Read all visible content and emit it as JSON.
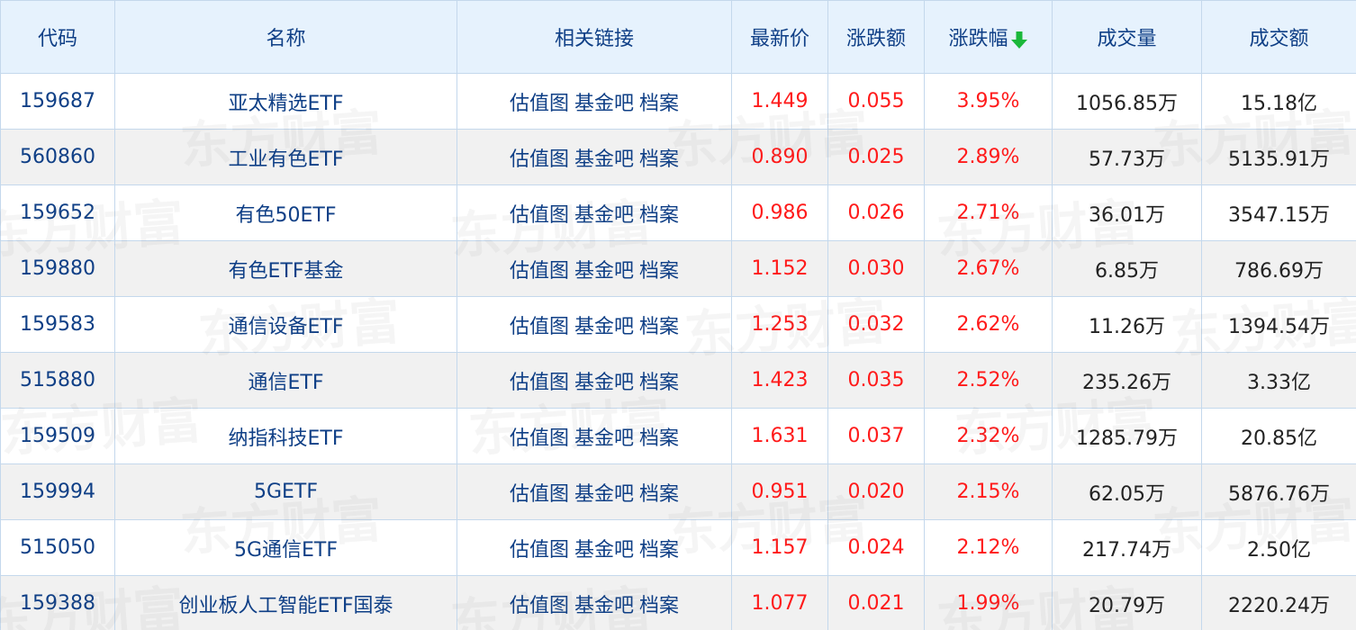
{
  "table": {
    "headers": [
      "代码",
      "名称",
      "相关链接",
      "最新价",
      "涨跌额",
      "涨跌幅",
      "成交量",
      "成交额"
    ],
    "sort_indicator": "arrow-down-icon",
    "sort_color": "#1bb83a",
    "link_labels": [
      "估值图",
      "基金吧",
      "档案"
    ],
    "rows": [
      {
        "code": "159687",
        "name": "亚太精选ETF",
        "price": "1.449",
        "change": "0.055",
        "pct": "3.95%",
        "volume": "1056.85万",
        "amount": "15.18亿"
      },
      {
        "code": "560860",
        "name": "工业有色ETF",
        "price": "0.890",
        "change": "0.025",
        "pct": "2.89%",
        "volume": "57.73万",
        "amount": "5135.91万"
      },
      {
        "code": "159652",
        "name": "有色50ETF",
        "price": "0.986",
        "change": "0.026",
        "pct": "2.71%",
        "volume": "36.01万",
        "amount": "3547.15万"
      },
      {
        "code": "159880",
        "name": "有色ETF基金",
        "price": "1.152",
        "change": "0.030",
        "pct": "2.67%",
        "volume": "6.85万",
        "amount": "786.69万"
      },
      {
        "code": "159583",
        "name": "通信设备ETF",
        "price": "1.253",
        "change": "0.032",
        "pct": "2.62%",
        "volume": "11.26万",
        "amount": "1394.54万"
      },
      {
        "code": "515880",
        "name": "通信ETF",
        "price": "1.423",
        "change": "0.035",
        "pct": "2.52%",
        "volume": "235.26万",
        "amount": "3.33亿"
      },
      {
        "code": "159509",
        "name": "纳指科技ETF",
        "price": "1.631",
        "change": "0.037",
        "pct": "2.32%",
        "volume": "1285.79万",
        "amount": "20.85亿"
      },
      {
        "code": "159994",
        "name": "5GETF",
        "price": "0.951",
        "change": "0.020",
        "pct": "2.15%",
        "volume": "62.05万",
        "amount": "5876.76万"
      },
      {
        "code": "515050",
        "name": "5G通信ETF",
        "price": "1.157",
        "change": "0.024",
        "pct": "2.12%",
        "volume": "217.74万",
        "amount": "2.50亿"
      },
      {
        "code": "159388",
        "name": "创业板人工智能ETF国泰",
        "price": "1.077",
        "change": "0.021",
        "pct": "1.99%",
        "volume": "20.79万",
        "amount": "2220.24万"
      }
    ]
  },
  "watermark": "东方财富",
  "colors": {
    "header_bg": "#e6f2fd",
    "link": "#0f3f86",
    "up": "#ff1a1a",
    "border": "#c4d8ec"
  }
}
